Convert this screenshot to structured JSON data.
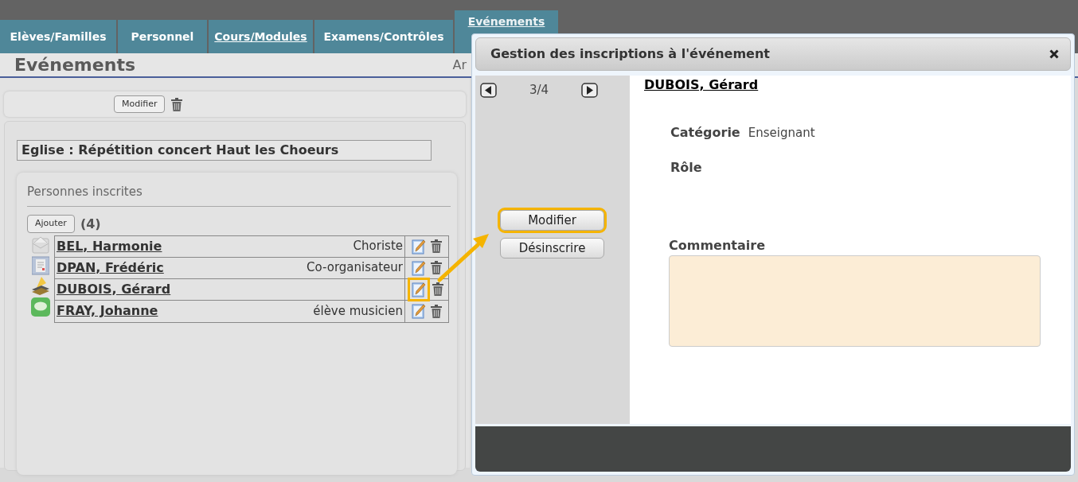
{
  "nav_tabs": [
    {
      "label": "Elèves/Familles",
      "selected": false,
      "underlined": false
    },
    {
      "label": "Personnel",
      "selected": false,
      "underlined": false
    },
    {
      "label": "Cours/Modules",
      "selected": false,
      "underlined": true
    },
    {
      "label": "Examens/Contrôles",
      "selected": false,
      "underlined": false
    },
    {
      "label": "Evénements",
      "selected": true,
      "underlined": true
    }
  ],
  "page": {
    "heading": "Evénements",
    "heading_right": "Ar"
  },
  "toolbar": {
    "button": "Modifier"
  },
  "event_title": "Eglise : Répétition concert Haut les Choeurs",
  "registrations": {
    "title": "Personnes inscrites",
    "add_button": "Ajouter",
    "count": "(4)",
    "rows": [
      {
        "name": "BEL, Harmonie",
        "role": "Choriste",
        "highlighted": false
      },
      {
        "name": "DPAN, Frédéric",
        "role": "Co-organisateur",
        "highlighted": false
      },
      {
        "name": "DUBOIS, Gérard",
        "highlighted": true
      },
      {
        "name": "FRAY, Johanne",
        "role": "élève musicien",
        "highlighted": false
      }
    ]
  },
  "modal": {
    "title": "Gestion des inscriptions à l'événement",
    "pager": "3/4",
    "person_name": "DUBOIS, Gérard",
    "fields": [
      {
        "label": "Catégorie",
        "value": "Enseignant"
      },
      {
        "label": "Rôle"
      }
    ],
    "buttons": [
      {
        "label": "Modifier",
        "highlighted": true
      },
      {
        "label": "Désinscrire",
        "highlighted": false
      }
    ],
    "comment_label": "Commentaire"
  }
}
